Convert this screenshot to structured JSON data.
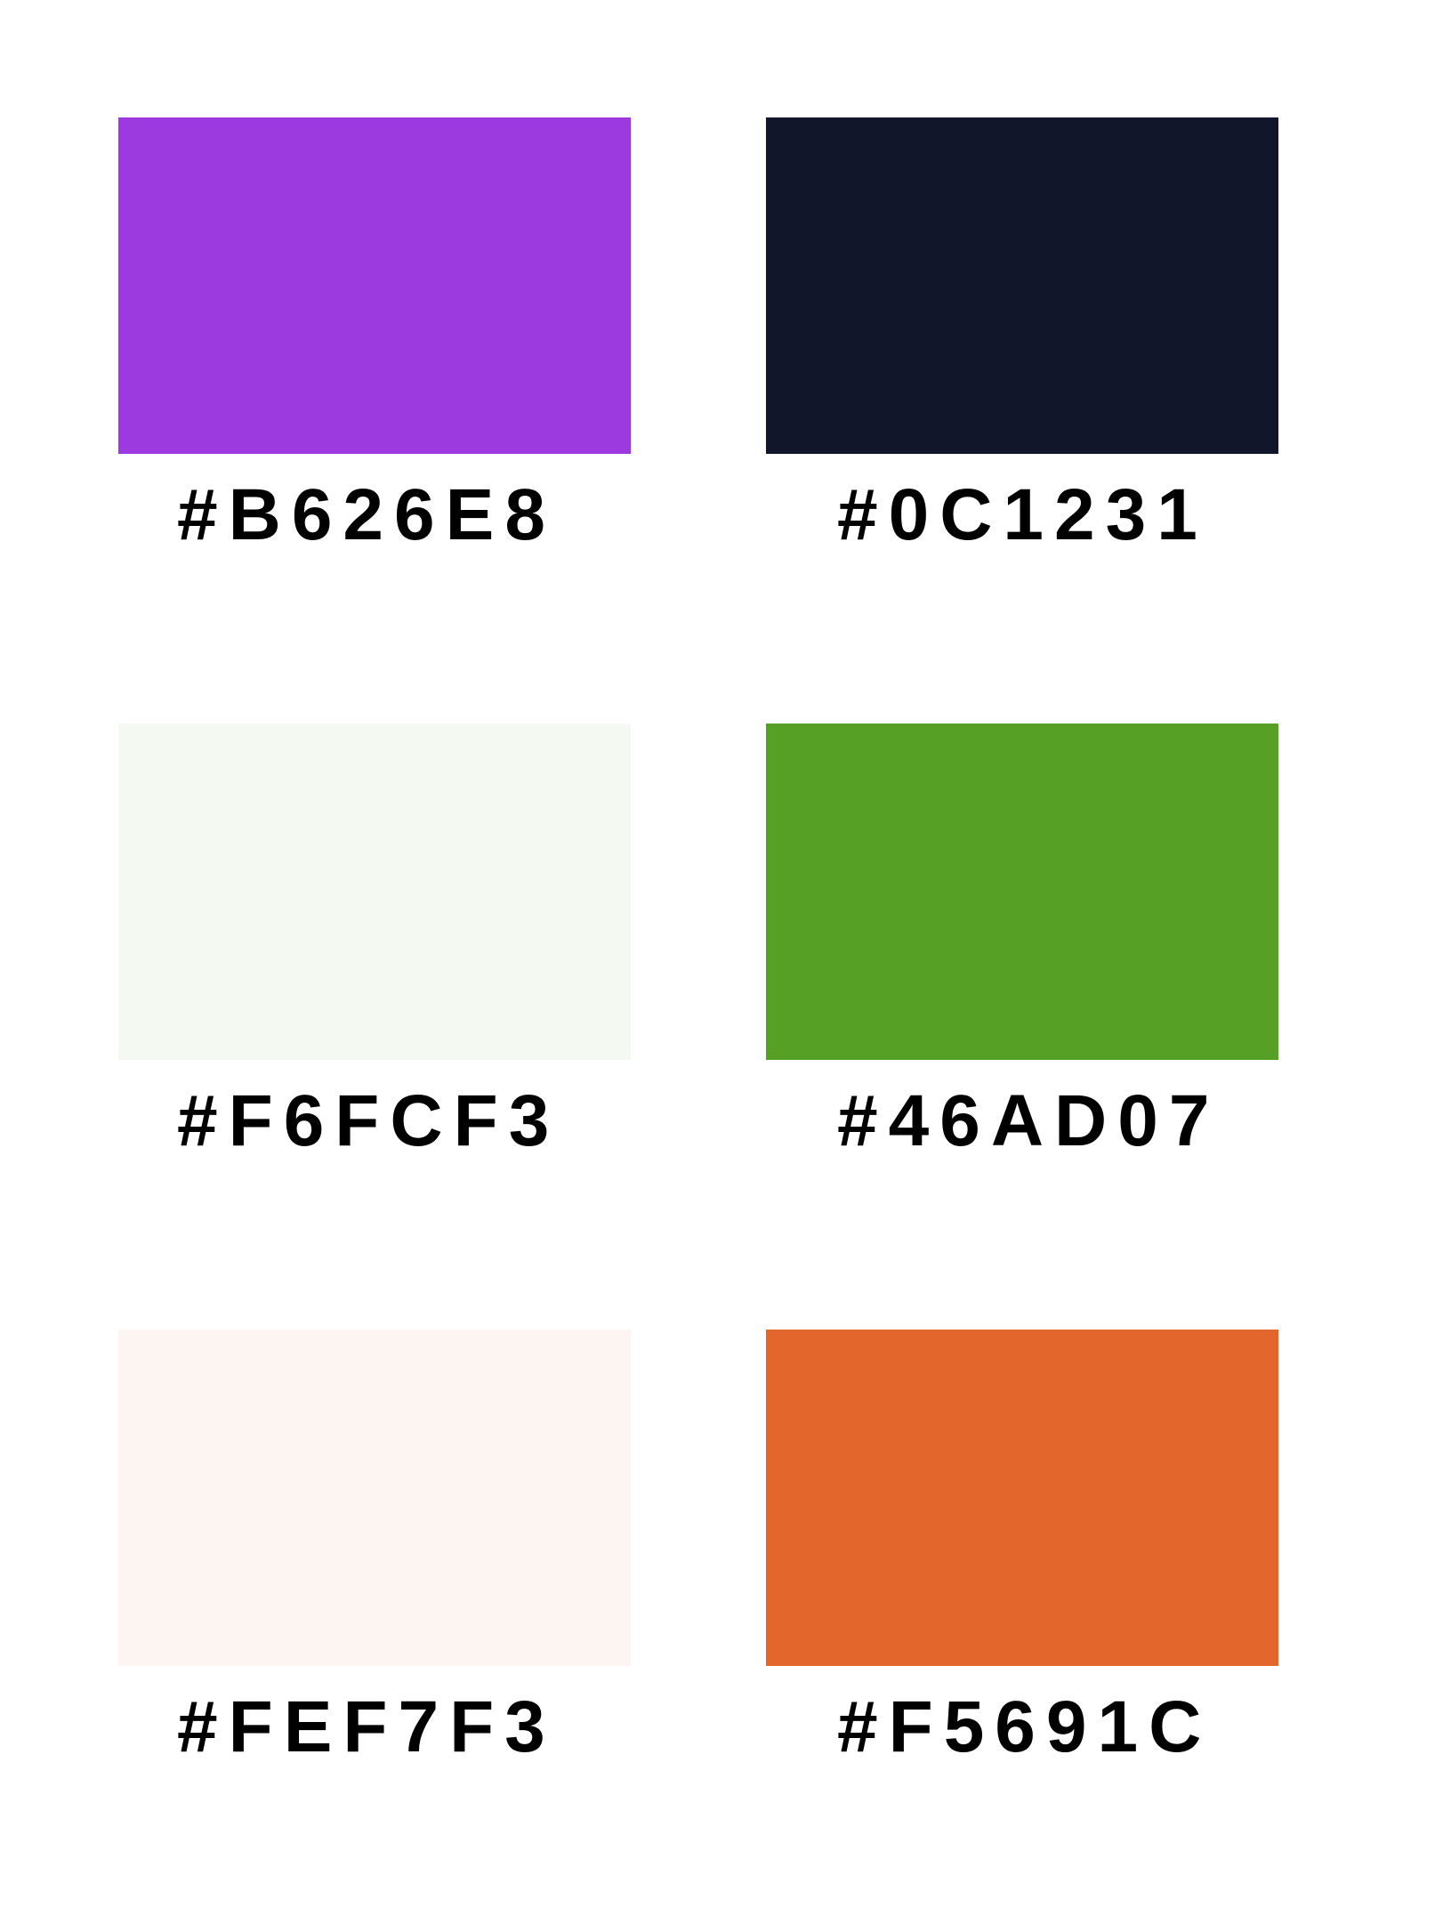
{
  "swatches": [
    {
      "hex_label": "#B626E8",
      "fill": "#9D3ADF"
    },
    {
      "hex_label": "#0C1231",
      "fill": "#12162B"
    },
    {
      "hex_label": "#F6FCF3",
      "fill": "#F4FAF2"
    },
    {
      "hex_label": "#46AD07",
      "fill": "#57A026"
    },
    {
      "hex_label": "#FEF7F3",
      "fill": "#FDF5F2"
    },
    {
      "hex_label": "#F5691C",
      "fill": "#E3672C"
    }
  ]
}
